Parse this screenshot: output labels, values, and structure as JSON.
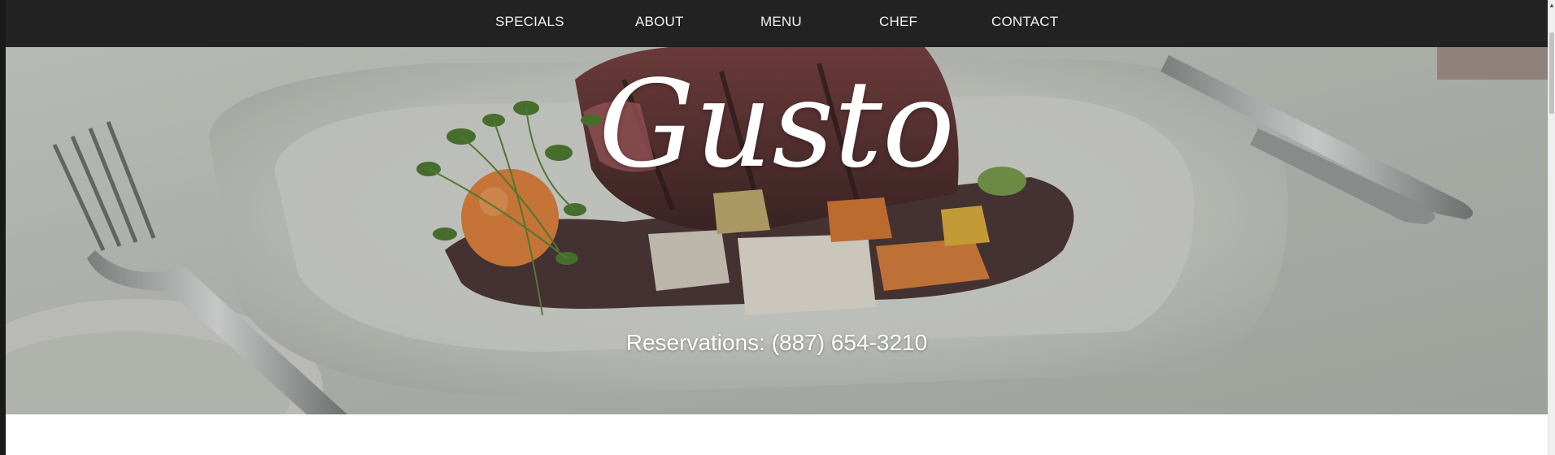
{
  "nav": {
    "items": [
      {
        "label": "SPECIALS"
      },
      {
        "label": "ABOUT"
      },
      {
        "label": "MENU"
      },
      {
        "label": "CHEF"
      },
      {
        "label": "CONTACT"
      }
    ]
  },
  "hero": {
    "brand": "Gusto",
    "reservations": "Reservations: (887) 654-3210",
    "image_subject": "plated steak with vegetables, fork and knife"
  },
  "colors": {
    "navbar": "#222222",
    "nav_text": "#f2f2f2",
    "hero_text": "#ffffff",
    "page_bg": "#ffffff"
  }
}
